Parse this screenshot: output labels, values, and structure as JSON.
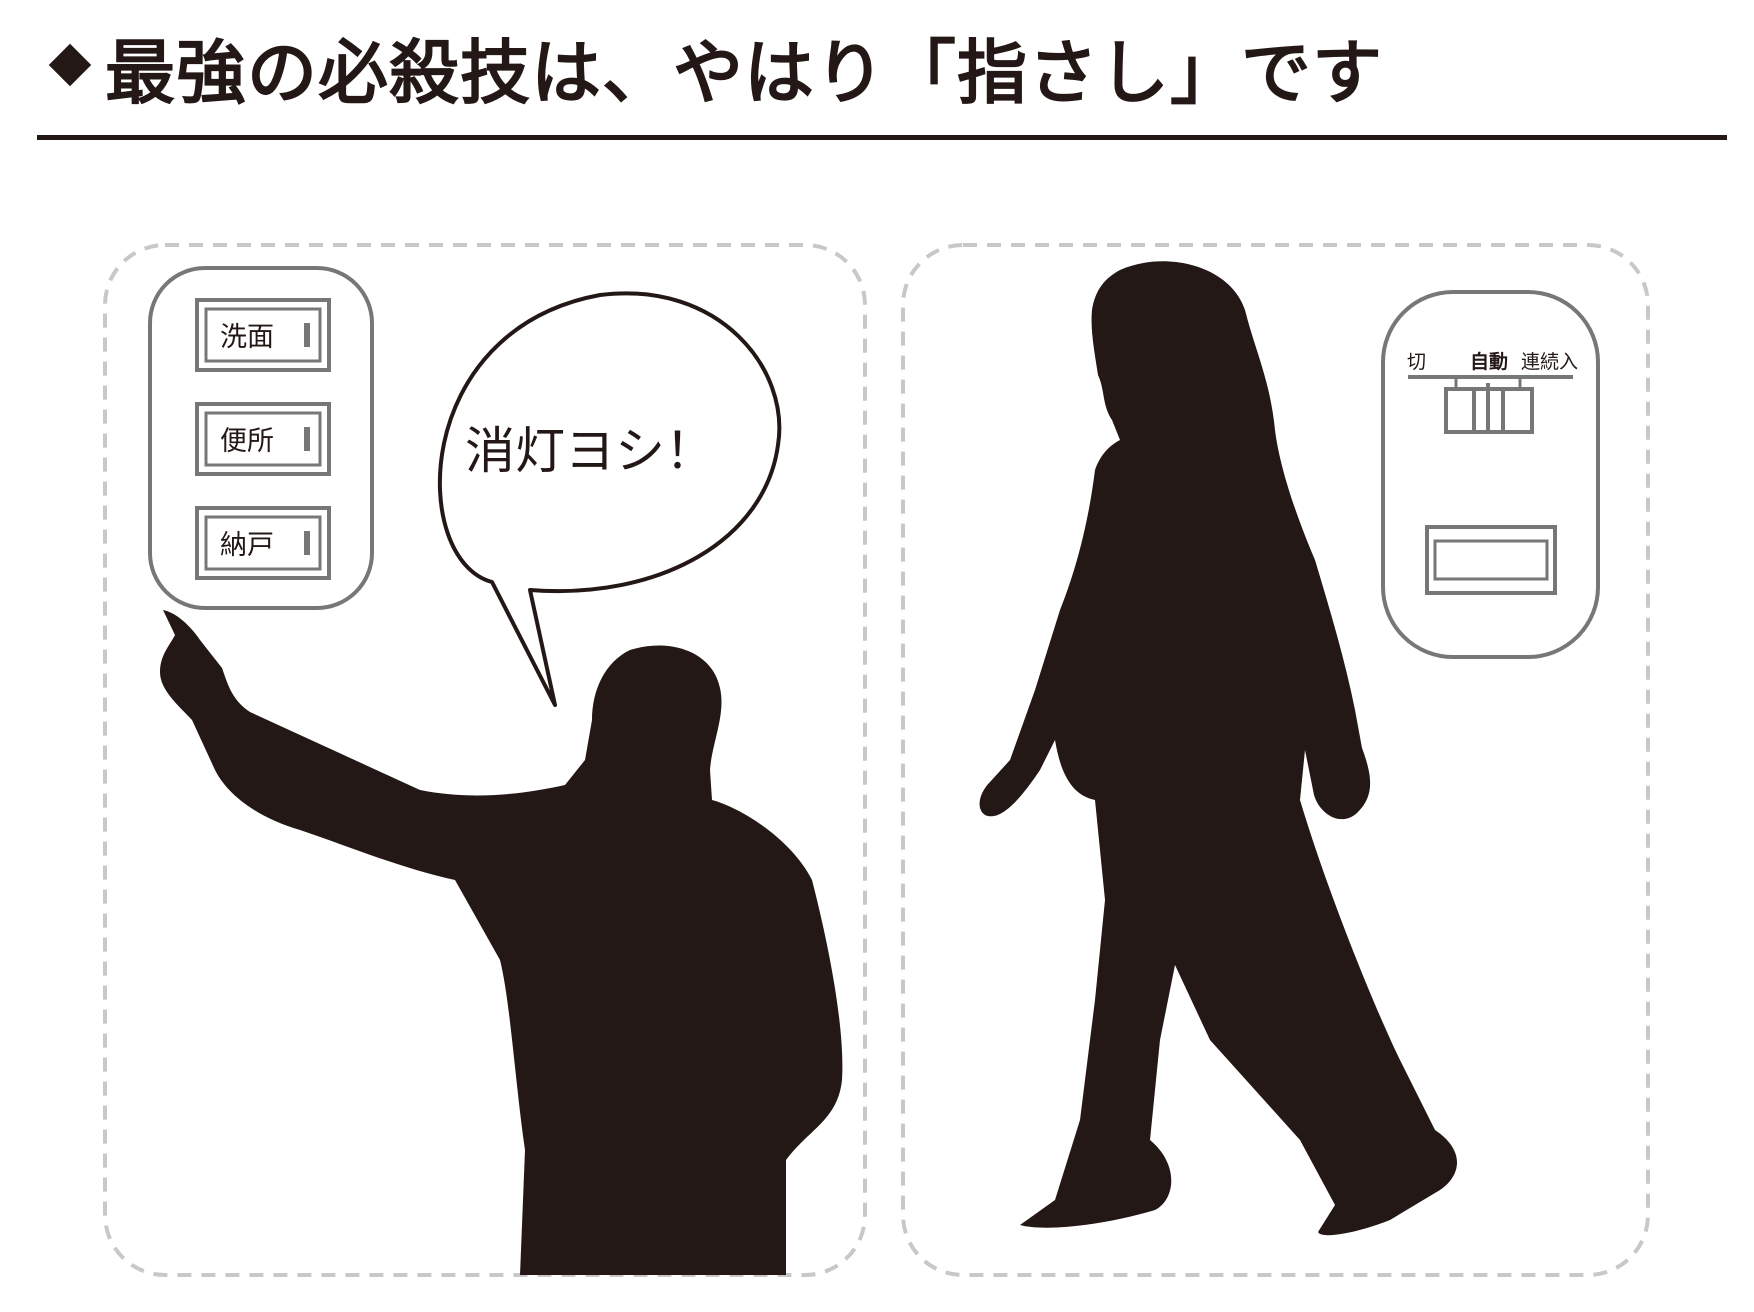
{
  "heading": {
    "title": "最強の必殺技は、やはり「指さし」です"
  },
  "left_panel": {
    "switches": [
      {
        "label": "洗面"
      },
      {
        "label": "便所"
      },
      {
        "label": "納戸"
      }
    ],
    "speech_bubble": {
      "text": "消灯ヨシ！"
    }
  },
  "right_panel": {
    "mode_switch": {
      "labels": [
        "切",
        "自動",
        "連続入"
      ]
    }
  },
  "colors": {
    "ink": "#231815",
    "outline_gray": "#777777",
    "dashed_border": "#c8c8c8"
  }
}
